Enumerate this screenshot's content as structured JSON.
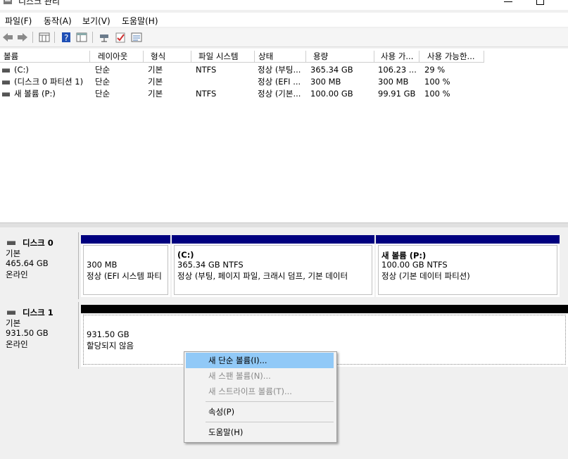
{
  "window": {
    "title": "디스크 관리"
  },
  "menu": [
    "파일(F)",
    "동작(A)",
    "보기(V)",
    "도움말(H)"
  ],
  "toolbar": {
    "icons": [
      "back-arrow-icon",
      "forward-arrow-icon",
      "properties-grid-icon",
      "help-icon",
      "panel-icon",
      "disk-connect-icon",
      "check-icon",
      "list-icon"
    ]
  },
  "volume_list": {
    "columns": [
      "볼륨",
      "레이아웃",
      "형식",
      "파일 시스템",
      "상태",
      "용량",
      "사용 가...",
      "사용 가능한..."
    ],
    "rows": [
      {
        "volume": "(C:)",
        "layout": "단순",
        "type": "기본",
        "fs": "NTFS",
        "status": "정상 (부팅...",
        "capacity": "365.34 GB",
        "free": "106.23 ...",
        "pct": "29 %"
      },
      {
        "volume": "(디스크 0 파티션 1)",
        "layout": "단순",
        "type": "기본",
        "fs": "",
        "status": "정상 (EFI ...",
        "capacity": "300 MB",
        "free": "300 MB",
        "pct": "100 %"
      },
      {
        "volume": "새 볼륨 (P:)",
        "layout": "단순",
        "type": "기본",
        "fs": "NTFS",
        "status": "정상 (기본...",
        "capacity": "100.00 GB",
        "free": "99.91 GB",
        "pct": "100 %"
      }
    ]
  },
  "disks": [
    {
      "name": "디스크 0",
      "kind": "기본",
      "size": "465.64 GB",
      "state": "온라인",
      "partitions": [
        {
          "title": "",
          "size": "300 MB",
          "status": "정상 (EFI 시스템 파티"
        },
        {
          "title": "(C:)",
          "size": "365.34 GB NTFS",
          "status": "정상 (부팅, 페이지 파일, 크래시 덤프, 기본 데이터"
        },
        {
          "title": "새 볼륨  (P:)",
          "size": "100.00 GB NTFS",
          "status": "정상 (기본 데이터 파티션)"
        }
      ]
    },
    {
      "name": "디스크 1",
      "kind": "기본",
      "size": "931.50 GB",
      "state": "온라인",
      "partitions": [
        {
          "title": "",
          "size": "931.50 GB",
          "status": "할당되지 않음"
        }
      ]
    }
  ],
  "context_menu": {
    "items": [
      {
        "label": "새 단순 볼륨(I)...",
        "enabled": true,
        "highlighted": true
      },
      {
        "label": "새 스팬 볼륨(N)...",
        "enabled": false
      },
      {
        "label": "새 스트라이프 볼륨(T)...",
        "enabled": false
      },
      {
        "label": "속성(P)",
        "enabled": true
      },
      {
        "label": "도움말(H)",
        "enabled": true
      }
    ]
  },
  "colors": {
    "partition_bar": "#00007f",
    "unallocated_bar": "#000000",
    "menu_highlight": "#91c9f7"
  }
}
